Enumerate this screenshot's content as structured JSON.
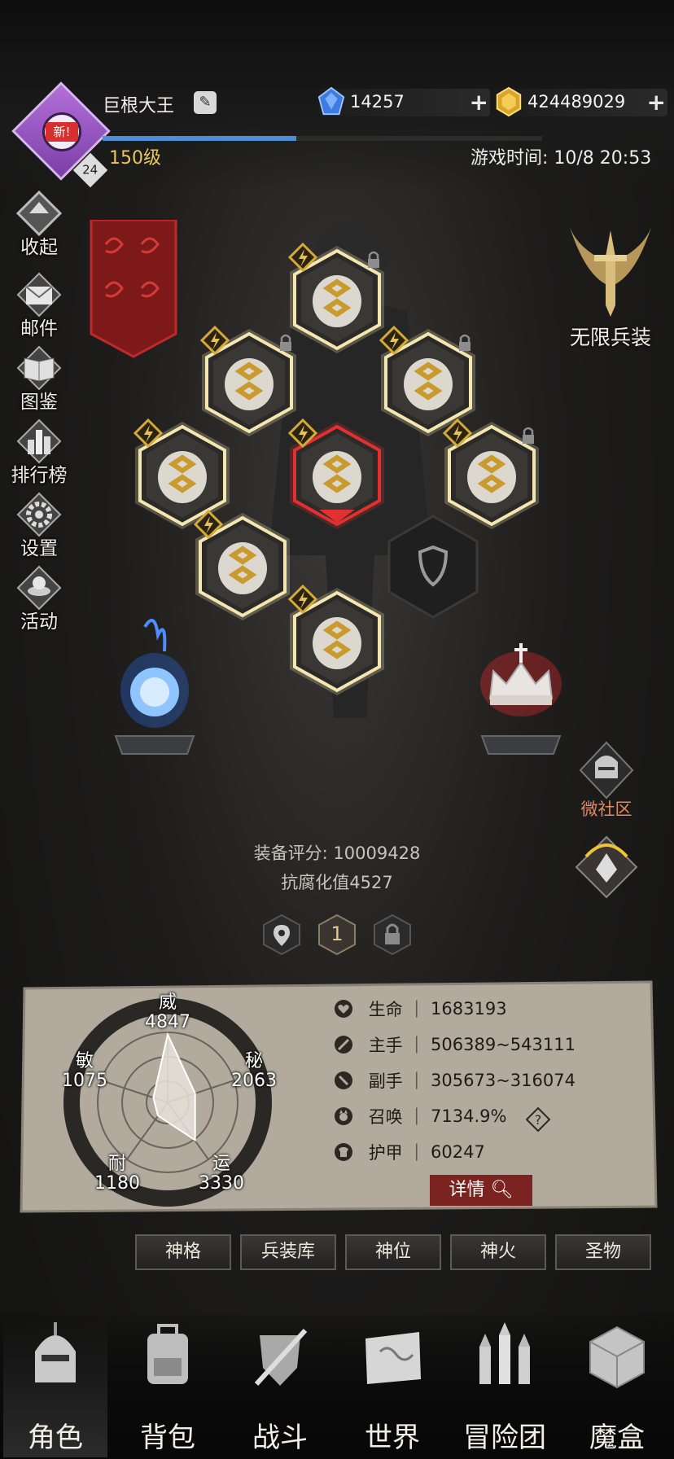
{
  "player": {
    "name": "巨根大王",
    "level_text": "150级",
    "level_badge": "24",
    "new_tag": "新!",
    "xp_fraction": 0.44
  },
  "currency": {
    "gems": "14257",
    "gold": "424489029"
  },
  "game_time": "游戏时间: 10/8 20:53",
  "side_menu": [
    {
      "label": "收起",
      "icon": "collapse-icon"
    },
    {
      "label": "邮件",
      "icon": "mail-icon"
    },
    {
      "label": "图鉴",
      "icon": "book-icon"
    },
    {
      "label": "排行榜",
      "icon": "ranking-icon"
    },
    {
      "label": "设置",
      "icon": "gear-icon"
    },
    {
      "label": "活动",
      "icon": "event-icon"
    }
  ],
  "unlimited_equip": "无限兵装",
  "community": "微社区",
  "equipment_score": "装备评分: 10009428",
  "corruption_resist": "抗腐化值4527",
  "loadout_slot": "1",
  "radar": {
    "wei": {
      "label": "威",
      "value": "4847"
    },
    "mi": {
      "label": "秘",
      "value": "2063"
    },
    "yun": {
      "label": "运",
      "value": "3330"
    },
    "nai": {
      "label": "耐",
      "value": "1180"
    },
    "min": {
      "label": "敏",
      "value": "1075"
    }
  },
  "stats": [
    {
      "name": "生命",
      "value": "1683193",
      "icon": "heart-icon"
    },
    {
      "name": "主手",
      "value": "506389~543111",
      "icon": "sword-icon"
    },
    {
      "name": "副手",
      "value": "305673~316074",
      "icon": "dagger-icon"
    },
    {
      "name": "召唤",
      "value": "7134.9%",
      "icon": "summon-icon"
    },
    {
      "name": "护甲",
      "value": "60247",
      "icon": "armor-icon"
    }
  ],
  "detail_button": "详情",
  "tabs": [
    "神格",
    "兵装库",
    "神位",
    "神火",
    "圣物"
  ],
  "bottom_nav": [
    {
      "label": "角色",
      "icon": "helmet-icon"
    },
    {
      "label": "背包",
      "icon": "backpack-icon"
    },
    {
      "label": "战斗",
      "icon": "battle-icon"
    },
    {
      "label": "世界",
      "icon": "map-icon"
    },
    {
      "label": "冒险团",
      "icon": "castle-icon"
    },
    {
      "label": "魔盒",
      "icon": "cube-icon"
    }
  ],
  "colors": {
    "accent_gold": "#e9c75a",
    "xp_blue": "#4c8fd6",
    "red_accent": "#c0282a",
    "panel_parchment": "#b7b0a3"
  }
}
